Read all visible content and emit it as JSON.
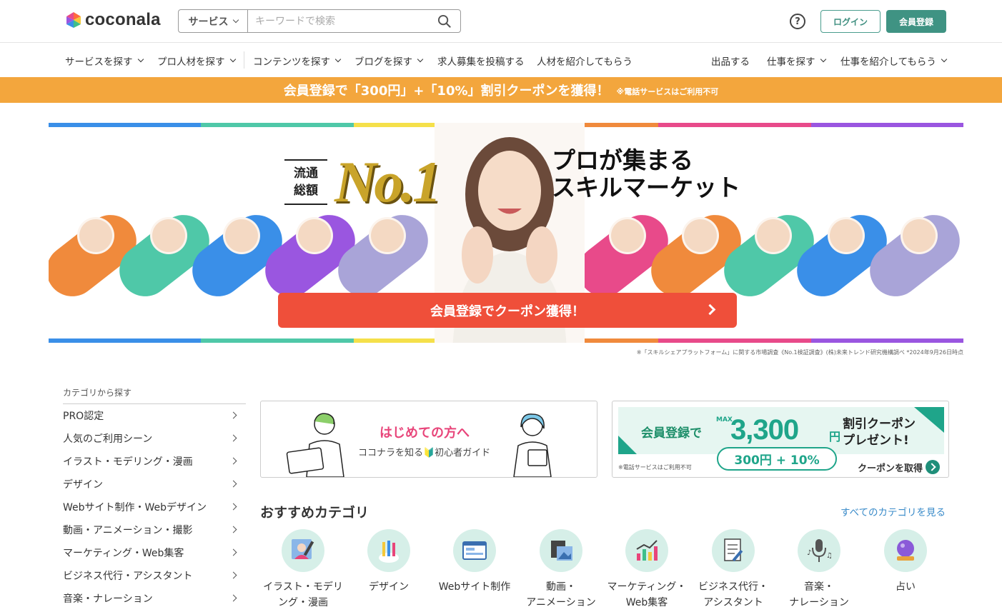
{
  "header": {
    "logo_text": "coconala",
    "search": {
      "category": "サービス",
      "placeholder": "キーワードで検索"
    },
    "help": "?",
    "login": "ログイン",
    "signup": "会員登録"
  },
  "nav": {
    "left": [
      "サービスを探す",
      "プロ人材を探す",
      "コンテンツを探す",
      "ブログを探す",
      "求人募集を投稿する",
      "人材を紹介してもらう"
    ],
    "right": [
      "出品する",
      "仕事を探す",
      "仕事を紹介してもらう"
    ]
  },
  "promo": {
    "main": "会員登録で「300円」+「10%」割引クーポンを獲得！",
    "note": "※電話サービスはご利用不可"
  },
  "hero": {
    "label_line1": "流通",
    "label_line2": "総額",
    "no1": "No.1",
    "tagline_line1": "プロが集まる",
    "tagline_line2": "スキルマーケット",
    "cta": "会員登録でクーポン獲得！",
    "footnote": "※「スキルシェアプラットフォーム」に関する市場調査《No.1検証調査》(株)未来トレンド研究機構調べ *2024年9月26日時点",
    "stripe_colors": [
      "#3a8fe8",
      "#4fc8a8",
      "#f5e04a",
      "#f08a3c",
      "#e84a8a",
      "#9a56e0"
    ]
  },
  "sidebar": {
    "heading": "カテゴリから探す",
    "items": [
      "PRO認定",
      "人気のご利用シーン",
      "イラスト・モデリング・漫画",
      "デザイン",
      "Webサイト制作・Webデザイン",
      "動画・アニメーション・撮影",
      "マーケティング・Web集客",
      "ビジネス代行・アシスタント",
      "音楽・ナレーション"
    ]
  },
  "banner_beginner": {
    "title": "はじめての方へ",
    "subtitle": "ココナラを知る🔰初心者ガイド"
  },
  "banner_coupon": {
    "lead": "会員登録で",
    "max": "MAX",
    "amount": "3,300",
    "yen": "円",
    "right_line1": "割引クーポン",
    "right_line2": "プレゼント!",
    "pill": "300円 + 10%",
    "note": "※電話サービスはご利用不可",
    "link": "クーポンを取得"
  },
  "recommended": {
    "title": "おすすめカテゴリ",
    "see_all": "すべてのカテゴリを見る",
    "categories": [
      {
        "line1": "イラスト・モデリ",
        "line2": "ング・漫画",
        "icon": "illustration-icon"
      },
      {
        "line1": "デザイン",
        "line2": "",
        "icon": "design-icon"
      },
      {
        "line1": "Webサイト制作",
        "line2": "",
        "icon": "website-icon"
      },
      {
        "line1": "動画・",
        "line2": "アニメーション",
        "icon": "video-icon"
      },
      {
        "line1": "マーケティング・",
        "line2": "Web集客",
        "icon": "marketing-icon"
      },
      {
        "line1": "ビジネス代行・",
        "line2": "アシスタント",
        "icon": "business-icon"
      },
      {
        "line1": "音楽・",
        "line2": "ナレーション",
        "icon": "music-icon"
      },
      {
        "line1": "占い",
        "line2": "",
        "icon": "fortune-icon"
      }
    ]
  }
}
